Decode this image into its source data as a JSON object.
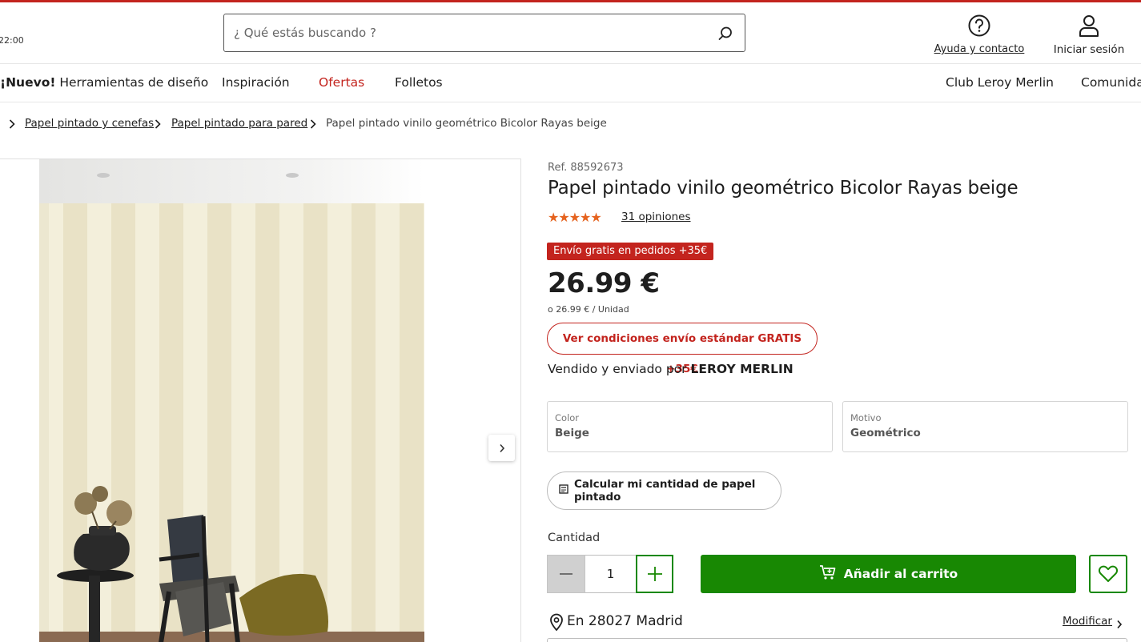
{
  "header": {
    "hours_fragment": "22:00",
    "search_placeholder": "¿ Qué estás buscando ?",
    "help_label": "Ayuda y contacto",
    "login_label": "Iniciar sesión",
    "brand_color": "#c3241e"
  },
  "nav": {
    "new_badge": "¡Nuevo!",
    "items": [
      "Herramientas de diseño",
      "Inspiración",
      "Ofertas",
      "Folletos",
      "Club Leroy Merlin",
      "Comunida"
    ]
  },
  "breadcrumb": {
    "links": [
      "Papel pintado y cenefas",
      "Papel pintado para pared"
    ],
    "current": "Papel pintado vinilo geométrico Bicolor Rayas beige"
  },
  "product": {
    "ref": "Ref. 88592673",
    "title": "Papel pintado vinilo geométrico Bicolor Rayas beige",
    "rating_stars": "★★★★★",
    "rating": 5,
    "reviews": "31 opiniones",
    "promo_badge": "Envío gratis en pedidos +35€",
    "price": "26.99 €",
    "unit_price": "o 26.99 € / Unidad",
    "shipping_button": "Ver condiciones envío estándar GRATIS +35€",
    "seller_prefix": "Vendido y enviado por",
    "seller_name": "LEROY MERLIN",
    "attributes": [
      {
        "label": "Color",
        "value": "Beige"
      },
      {
        "label": "Motivo",
        "value": "Geométrico"
      }
    ],
    "calculator_button": "Calcular mi cantidad de papel pintado",
    "quantity_label": "Cantidad",
    "quantity_value": "1",
    "add_to_cart": "Añadir al carrito",
    "cart_color": "#188803"
  },
  "location": {
    "text": "En 28027 Madrid",
    "modify": "Modificar"
  }
}
